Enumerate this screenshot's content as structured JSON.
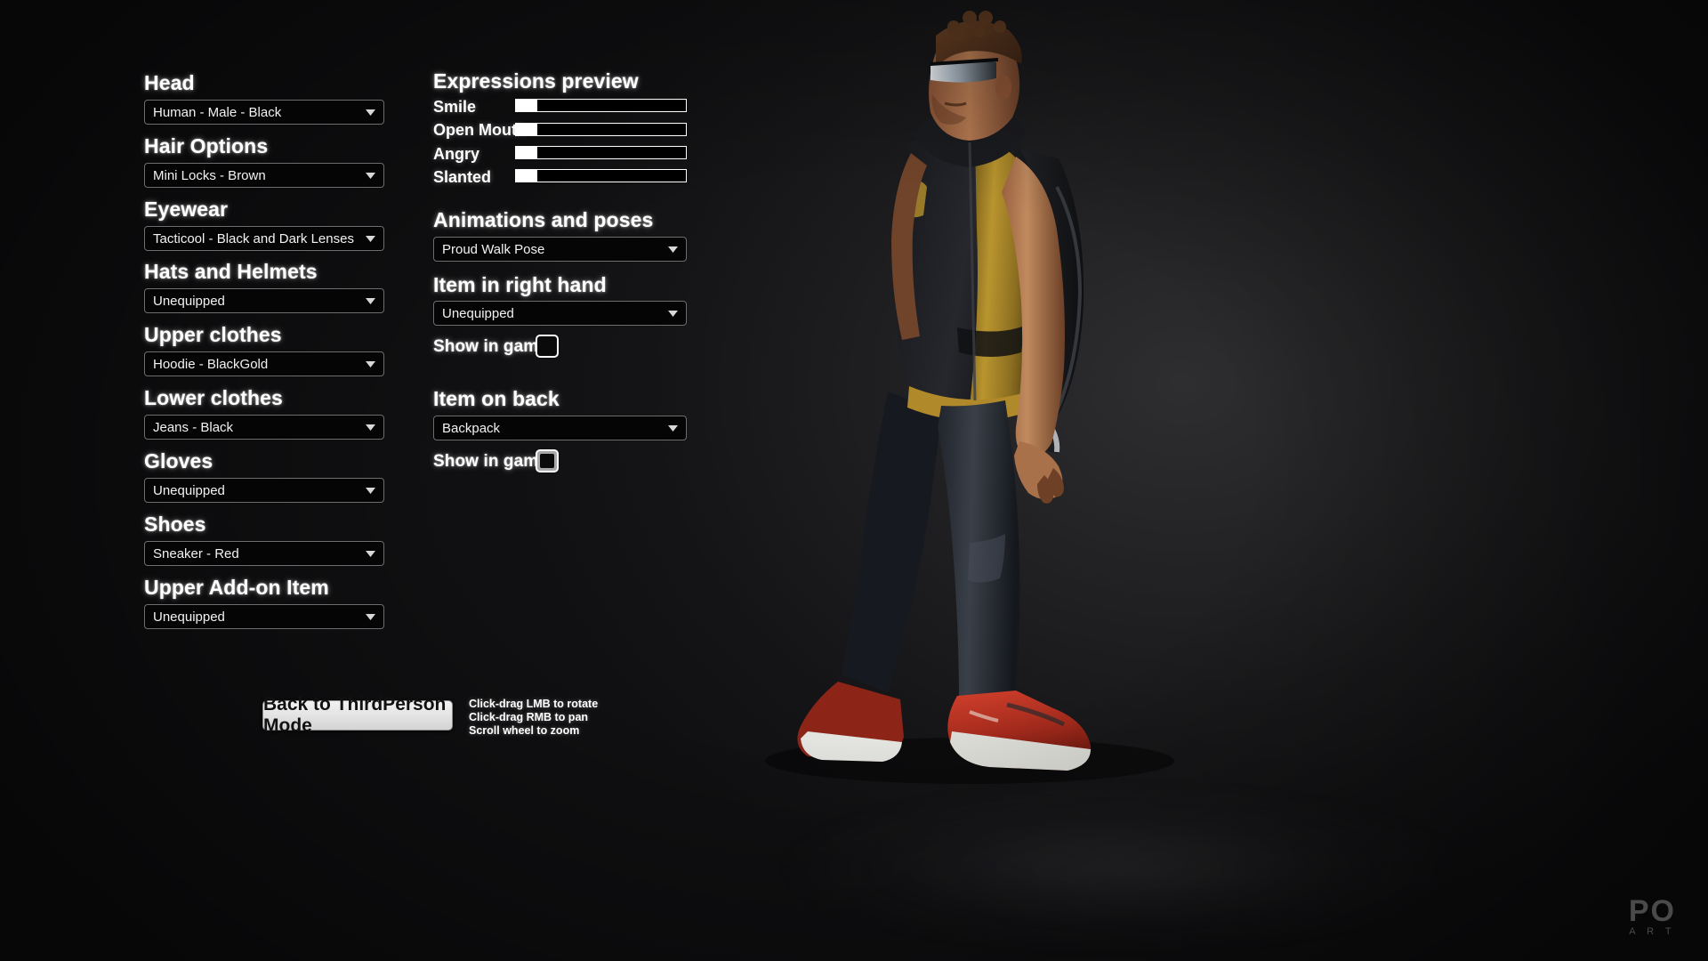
{
  "left_panel": {
    "groups": [
      {
        "label": "Head",
        "value": "Human - Male - Black"
      },
      {
        "label": "Hair Options",
        "value": "Mini Locks - Brown"
      },
      {
        "label": "Eyewear",
        "value": "Tacticool -  Black and Dark Lenses"
      },
      {
        "label": "Hats and Helmets",
        "value": "Unequipped"
      },
      {
        "label": "Upper clothes",
        "value": "Hoodie - BlackGold"
      },
      {
        "label": "Lower clothes",
        "value": "Jeans - Black"
      },
      {
        "label": "Gloves",
        "value": "Unequipped"
      },
      {
        "label": "Shoes",
        "value": "Sneaker - Red"
      },
      {
        "label": "Upper Add-on Item",
        "value": "Unequipped"
      }
    ]
  },
  "right_panel": {
    "expressions_title": "Expressions preview",
    "expressions": [
      {
        "label": "Smile",
        "value": 0
      },
      {
        "label": "Open Mouth",
        "value": 0
      },
      {
        "label": "Angry",
        "value": 0
      },
      {
        "label": "Slanted",
        "value": 0
      }
    ],
    "animations_title": "Animations and poses",
    "animations_value": "Proud Walk Pose",
    "right_hand_title": "Item in right hand",
    "right_hand_value": "Unequipped",
    "right_hand_show_label": "Show in game",
    "right_hand_show_checked": false,
    "back_title": "Item on back",
    "back_value": "Backpack",
    "back_show_label": "Show in game",
    "back_show_checked": false
  },
  "footer": {
    "button_label": "Back to ThirdPerson Mode",
    "hint_line_1": "Click-drag LMB to rotate",
    "hint_line_2": "Click-drag RMB to pan",
    "hint_line_3": "Scroll wheel to zoom"
  },
  "watermark": {
    "main": "PO",
    "sub": "A R T"
  },
  "colors": {
    "background": "#121212",
    "text": "#ffffff",
    "dropdown_bg": "#050505",
    "dropdown_border": "#6e6e6e",
    "slider_fill": "#ffffff",
    "button_bg": "#e6e6e6"
  }
}
